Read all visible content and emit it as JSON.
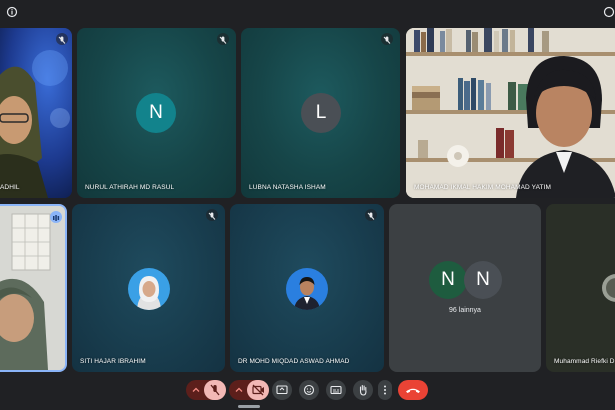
{
  "participants": [
    {
      "id": "p1",
      "name": "ADHIL",
      "type": "video"
    },
    {
      "id": "p2",
      "name": "NURUL ATHIRAH MD RASUL",
      "initial": "N",
      "type": "avatar",
      "avatar_color": "#12838c"
    },
    {
      "id": "p3",
      "name": "LUBNA NATASHA ISHAM",
      "initial": "L",
      "type": "avatar",
      "avatar_color": "#4a4f55"
    },
    {
      "id": "p4",
      "name": "MOHAMAD IKMAL HAKIM MOHAMAD YATIM",
      "type": "video"
    },
    {
      "id": "p5",
      "name": "",
      "type": "video"
    },
    {
      "id": "p6",
      "name": "SITI HAJAR IBRAHIM",
      "type": "photo"
    },
    {
      "id": "p7",
      "name": "DR MOHD MIQDAD ASWAD AHMAD",
      "type": "photo"
    },
    {
      "id": "p8",
      "others_label": "96 lainnya",
      "initials": [
        "N",
        "N"
      ],
      "avatar_colors": [
        "#1e5c3f",
        "#4a4f55"
      ],
      "type": "group"
    },
    {
      "id": "p9",
      "name": "Muhammad Riefki D",
      "type": "video"
    }
  ],
  "toolbar": {
    "icons": [
      "chevron-up-icon",
      "mic-off-icon",
      "chevron-up-icon",
      "camera-off-icon",
      "present-screen-icon",
      "emoji-icon",
      "captions-icon",
      "raise-hand-icon",
      "more-options-icon",
      "leave-call-icon"
    ]
  },
  "colors": {
    "background": "#202124",
    "tile_gray": "#3c4043",
    "danger_red": "#ea4335",
    "active_speaker_border": "#8ab4f8"
  }
}
